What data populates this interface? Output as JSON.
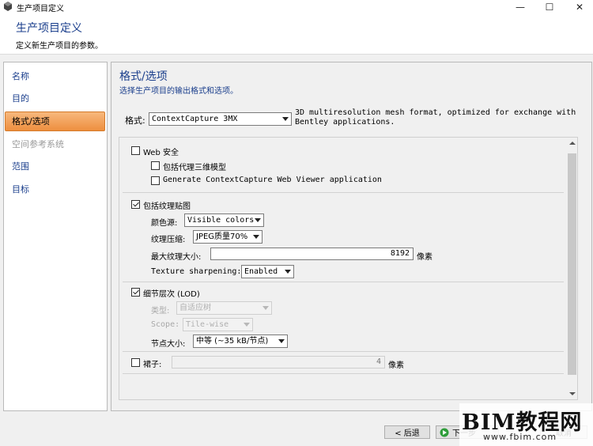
{
  "window": {
    "title": "生产项目定义",
    "controls": [
      "—",
      "☐",
      "✕"
    ]
  },
  "header": {
    "title": "生产项目定义",
    "subtitle": "定义新生产项目的参数。"
  },
  "nav": {
    "items": [
      {
        "label": "名称",
        "state": "normal"
      },
      {
        "label": "目的",
        "state": "normal"
      },
      {
        "label": "格式/选项",
        "state": "active"
      },
      {
        "label": "空间参考系统",
        "state": "disabled"
      },
      {
        "label": "范围",
        "state": "normal"
      },
      {
        "label": "目标",
        "state": "normal"
      }
    ]
  },
  "panel": {
    "title": "格式/选项",
    "subtitle": "选择生产项目的输出格式和选项。",
    "format_label": "格式:",
    "format_value": "ContextCapture 3MX",
    "format_desc": "3D multiresolution mesh format, optimized for exchange with Bentley applications."
  },
  "options": {
    "web_security": {
      "label": "Web 安全",
      "checked": false
    },
    "proxy_3d": {
      "label": "包括代理三维模型",
      "checked": false
    },
    "web_viewer": {
      "label": "Generate ContextCapture Web Viewer application",
      "checked": false
    },
    "texture": {
      "label": "包括纹理贴图",
      "checked": true
    },
    "color_source_label": "颜色源:",
    "color_source_value": "Visible colors",
    "compression_label": "纹理压缩:",
    "compression_value": "JPEG质量70%",
    "max_texture_label": "最大纹理大小:",
    "max_texture_value": "8192",
    "max_texture_unit": "像素",
    "sharpening_label": "Texture sharpening:",
    "sharpening_value": "Enabled",
    "lod": {
      "label": "细节层次 (LOD)",
      "checked": true
    },
    "lod_type_label": "类型:",
    "lod_type_value": "自适应树",
    "scope_label": "Scope:",
    "scope_value": "Tile-wise",
    "node_size_label": "节点大小:",
    "node_size_value": "中等 (~35 kB/节点)",
    "skirt": {
      "label": "裙子:",
      "checked": false
    },
    "skirt_value": "4",
    "skirt_unit": "像素"
  },
  "footer": {
    "back_label": "< 后退",
    "next_label": "下一步",
    "cancel_label": "取消"
  },
  "watermark": {
    "big": "BIM教程网",
    "small": "www.fbim.com"
  }
}
